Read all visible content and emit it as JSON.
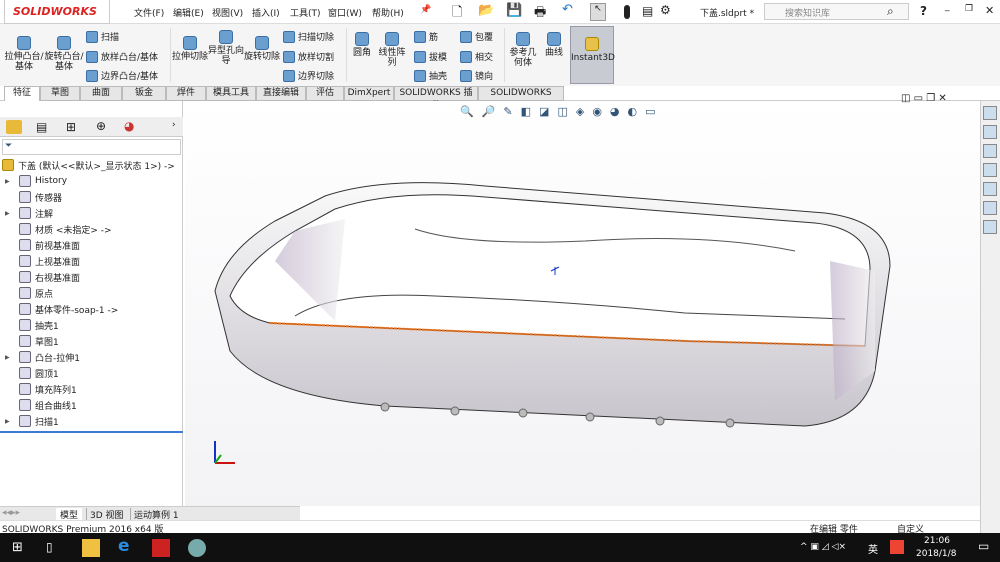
{
  "app": {
    "logo": "SOLIDWORKS",
    "doc_title": "下盖.sldprt *",
    "search_placeholder": "搜索知识库"
  },
  "menu": [
    "文件(F)",
    "编辑(E)",
    "视图(V)",
    "插入(I)",
    "工具(T)",
    "窗口(W)",
    "帮助(H)"
  ],
  "ribbon": {
    "large": [
      "拉伸凸台/基体",
      "旋转凸台/基体",
      "拉伸切除",
      "异型孔向导",
      "旋转切除",
      "圆角",
      "线性阵列",
      "参考几何体",
      "曲线",
      "Instant3D"
    ],
    "small": [
      "扫描",
      "放样凸台/基体",
      "边界凸台/基体",
      "扫描切除",
      "放样切割",
      "边界切除",
      "筋",
      "拔模",
      "抽壳",
      "包覆",
      "相交",
      "镜向"
    ]
  },
  "tabs": [
    "特征",
    "草图",
    "曲面",
    "钣金",
    "焊件",
    "模具工具",
    "直接编辑",
    "评估",
    "DimXpert",
    "SOLIDWORKS 插件",
    "SOLIDWORKS MBD"
  ],
  "tree": {
    "root": "下盖  (默认<<默认>_显示状态 1>) ->",
    "items": [
      {
        "label": "History",
        "expand": true
      },
      {
        "label": "传感器",
        "expand": false
      },
      {
        "label": "注解",
        "expand": true
      },
      {
        "label": "材质 <未指定> ->",
        "expand": false
      },
      {
        "label": "前视基准面",
        "expand": false
      },
      {
        "label": "上视基准面",
        "expand": false
      },
      {
        "label": "右视基准面",
        "expand": false
      },
      {
        "label": "原点",
        "expand": false
      },
      {
        "label": "基体零件-soap-1 ->",
        "expand": false
      },
      {
        "label": "抽壳1",
        "expand": false
      },
      {
        "label": "草图1",
        "expand": false
      },
      {
        "label": "凸台-拉伸1",
        "expand": true
      },
      {
        "label": "圆顶1",
        "expand": false
      },
      {
        "label": "填充阵列1",
        "expand": false
      },
      {
        "label": "组合曲线1",
        "expand": false
      },
      {
        "label": "扫描1",
        "expand": true
      }
    ]
  },
  "bottom_tabs": [
    "模型",
    "3D 视图",
    "运动算例 1"
  ],
  "status": {
    "left": "SOLIDWORKS Premium 2016 x64 版",
    "mid": "在编辑 零件",
    "right": "自定义"
  },
  "taskbar": {
    "time": "21:06",
    "date": "2018/1/8",
    "ime": "英"
  }
}
